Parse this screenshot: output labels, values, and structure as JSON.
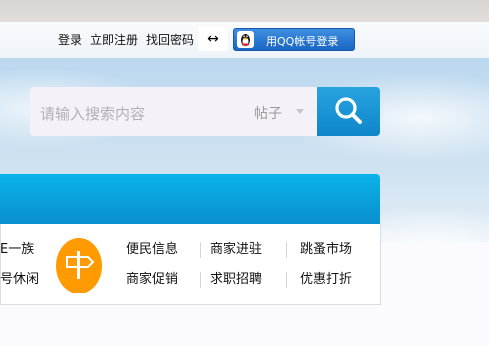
{
  "header": {
    "login": "登录",
    "register": "立即注册",
    "find_password": "找回密码",
    "swap_icon": "↔",
    "qq_login": "用QQ帐号登录"
  },
  "search": {
    "placeholder": "请输入搜索内容",
    "type": "帖子"
  },
  "categories": {
    "left_top": "E一族",
    "left_bottom": "号休闲",
    "items": [
      "便民信息",
      "商家进驻",
      "跳蚤市场",
      "商家促销",
      "求职招聘",
      "优惠打折"
    ]
  },
  "colors": {
    "accent": "#0f8ccd",
    "qq_button": "#2a78d4",
    "badge": "#ff9900"
  },
  "icons": [
    "qq-penguin-icon",
    "search-icon",
    "signpost-icon",
    "chevron-down-icon",
    "swap-arrows-icon"
  ]
}
